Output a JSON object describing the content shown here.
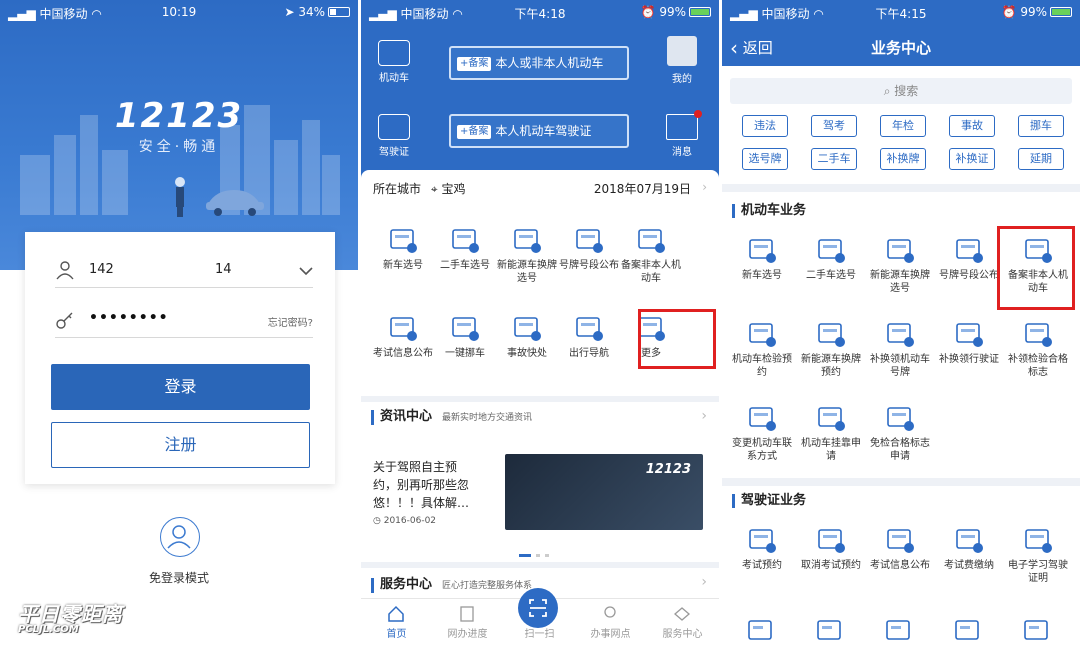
{
  "login": {
    "status": {
      "carrier": "中国移动",
      "time": "10:19",
      "battery": "34%"
    },
    "logo": "12123",
    "slogan": "安全·畅通",
    "username_left": "142",
    "username_right": "14",
    "password_mask": "••••••••",
    "forgot": "忘记密码?",
    "login_btn": "登录",
    "register_btn": "注册",
    "guest": "免登录模式",
    "watermark_main": "平日零距离",
    "watermark_sub": "PCLJL.COM",
    "colors": {
      "primary": "#2a66b8"
    }
  },
  "home": {
    "status": {
      "carrier": "中国移动",
      "time": "下午4:18",
      "battery": "99%"
    },
    "side": {
      "vehicle": "机动车",
      "license": "驾驶证",
      "mine": "我的",
      "message": "消息"
    },
    "reg_tag": "+备案",
    "reg_vehicle": "本人或非本人机动车",
    "reg_license": "本人机动车驾驶证",
    "city_label": "所在城市",
    "city": "宝鸡",
    "date": "2018年07月19日",
    "services": [
      {
        "label": "新车选号",
        "icon": "new-car-icon"
      },
      {
        "label": "二手车选号",
        "icon": "used-car-icon"
      },
      {
        "label": "新能源车换牌选号",
        "icon": "ev-icon"
      },
      {
        "label": "号牌号段公布",
        "icon": "plate-icon"
      },
      {
        "label": "备案非本人机动车",
        "icon": "file-icon"
      },
      {
        "label": "考试信息公布",
        "icon": "exam-icon"
      },
      {
        "label": "一键挪车",
        "icon": "move-car-icon"
      },
      {
        "label": "事故快处",
        "icon": "accident-icon"
      },
      {
        "label": "出行导航",
        "icon": "navigation-icon"
      },
      {
        "label": "更多",
        "icon": "more-icon"
      }
    ],
    "news_title": "资讯中心",
    "news_sub": "最新实时地方交通资讯",
    "news_text": "关于驾照自主预约，别再听那些忽悠！！！具体解…",
    "news_text_lines": [
      "关于驾照自主预",
      "约，别再听那些忽",
      "悠！！！具体解…"
    ],
    "news_date": "2016-06-02",
    "news_logo": "12123",
    "service_title": "服务中心",
    "service_sub": "匠心打造完整服务体系",
    "tabs": [
      "首页",
      "网办进度",
      "扫一扫",
      "办事网点",
      "服务中心"
    ]
  },
  "business": {
    "status": {
      "carrier": "中国移动",
      "time": "下午4:15",
      "battery": "99%"
    },
    "back": "返回",
    "title": "业务中心",
    "search": "搜索",
    "chips": [
      "违法",
      "驾考",
      "年检",
      "事故",
      "挪车",
      "选号牌",
      "二手车",
      "补换牌",
      "补换证",
      "延期"
    ],
    "vehicle_title": "机动车业务",
    "vehicle_items": [
      "新车选号",
      "二手车选号",
      "新能源车换牌选号",
      "号牌号段公布",
      "备案非本人机动车",
      "机动车检验预约",
      "新能源车换牌预约",
      "补换领机动车号牌",
      "补换领行驶证",
      "补领检验合格标志",
      "变更机动车联系方式",
      "机动车挂靠申请",
      "免检合格标志申请"
    ],
    "license_title": "驾驶证业务",
    "license_items": [
      "考试预约",
      "取消考试预约",
      "考试信息公布",
      "考试费缴纳",
      "电子学习驾驶证明"
    ]
  }
}
